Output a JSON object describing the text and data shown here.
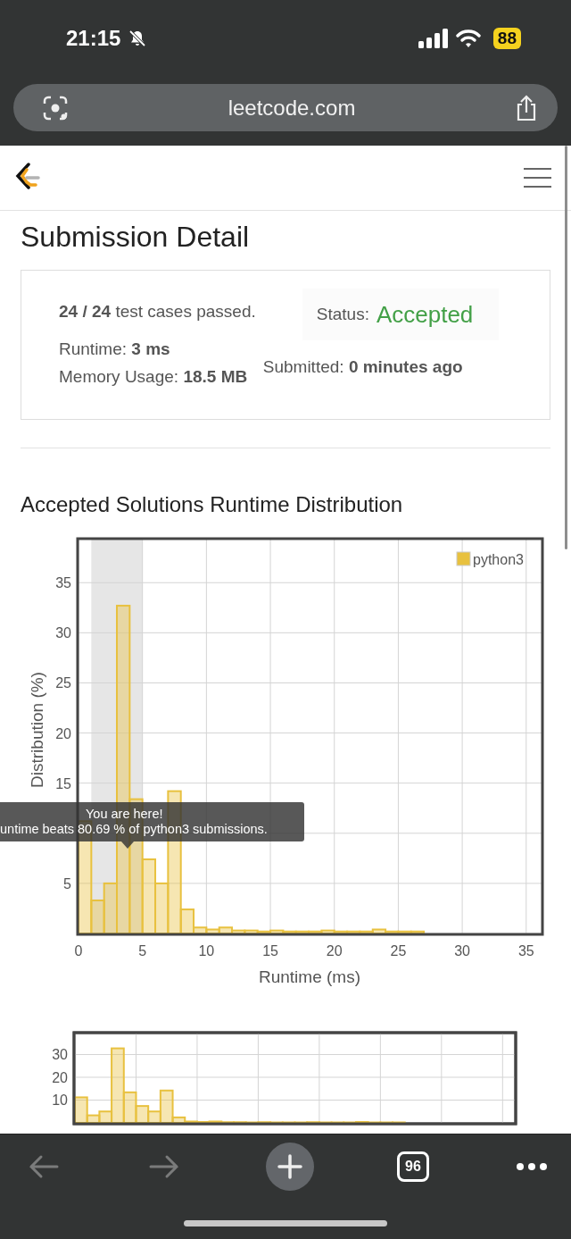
{
  "status_bar": {
    "time": "21:15",
    "battery": "88"
  },
  "address_bar": {
    "url": "leetcode.com"
  },
  "page_title": "Submission Detail",
  "summary": {
    "cases": "**24 / 24** test cases passed.",
    "runtime": "Runtime: **3 ms**",
    "memory": "Memory Usage: **18.5 MB**",
    "status_label": "Status:",
    "status_value": "Accepted",
    "submitted": "Submitted: **0 minutes ago**"
  },
  "distribution": {
    "heading": "Accepted Solutions Runtime Distribution",
    "chart_data": {
      "type": "bar",
      "xlabel": "Runtime (ms)",
      "ylabel": "Distribution (%)",
      "xlim": [
        0,
        36.2
      ],
      "ylim": [
        0,
        39.3
      ],
      "xticks": [
        0,
        5,
        10,
        15,
        20,
        25,
        30,
        35
      ],
      "yticks": [
        5,
        15,
        20,
        25,
        30,
        35
      ],
      "grid": true,
      "x": [
        0.5,
        1.5,
        2.5,
        3.5,
        4.5,
        5.5,
        6.5,
        7.5,
        8.5,
        9.5,
        10.5,
        11.5,
        12.5,
        13.5,
        14.5,
        15.5,
        16.5,
        17.5,
        18.5,
        19.5,
        20.5,
        21.5,
        22.5,
        23.5,
        24.5,
        25.5,
        26.5
      ],
      "series": [
        {
          "name": "python3",
          "color": "#e8c13f",
          "values": [
            11.2,
            3.3,
            5.0,
            32.7,
            13.4,
            7.4,
            5.0,
            14.2,
            2.4,
            0.6,
            0.4,
            0.6,
            0.3,
            0.3,
            0.2,
            0.3,
            0.2,
            0.2,
            0.2,
            0.3,
            0.2,
            0.2,
            0.2,
            0.4,
            0.2,
            0.2,
            0.2
          ]
        }
      ],
      "bands": [
        {
          "axis": "x",
          "from": 1,
          "to": 5
        }
      ]
    },
    "tooltip": {
      "title": "You are here!",
      "text": "untime beats 80.69 % of python3 submissions."
    }
  },
  "overview": {
    "y_labels": [
      "30",
      "20",
      "10"
    ]
  },
  "toolbar": {
    "back": {
      "disabled": true
    },
    "forward": {
      "disabled": true
    },
    "tab_count": "96"
  }
}
